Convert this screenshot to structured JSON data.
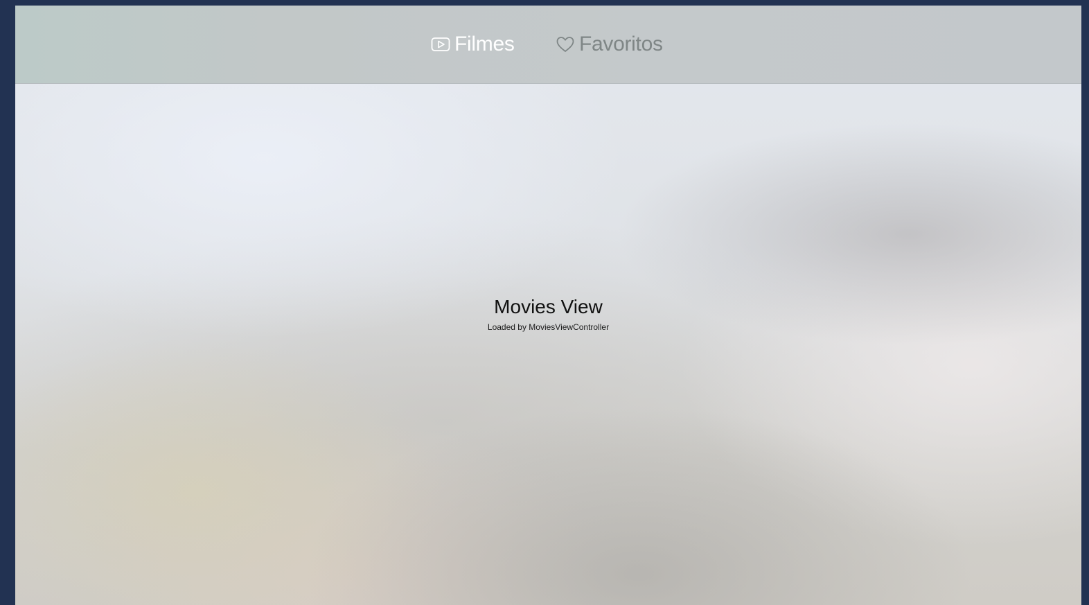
{
  "tabbar": {
    "tabs": [
      {
        "label": "Filmes",
        "icon": "play-rectangle-icon",
        "selected": true
      },
      {
        "label": "Favoritos",
        "icon": "heart-icon",
        "selected": false
      }
    ]
  },
  "main": {
    "title": "Movies View",
    "subtitle": "Loaded by MoviesViewController"
  },
  "colors": {
    "selected_tab": "#ffffff",
    "unselected_tab": "#7f8686",
    "frame": "#223252"
  }
}
